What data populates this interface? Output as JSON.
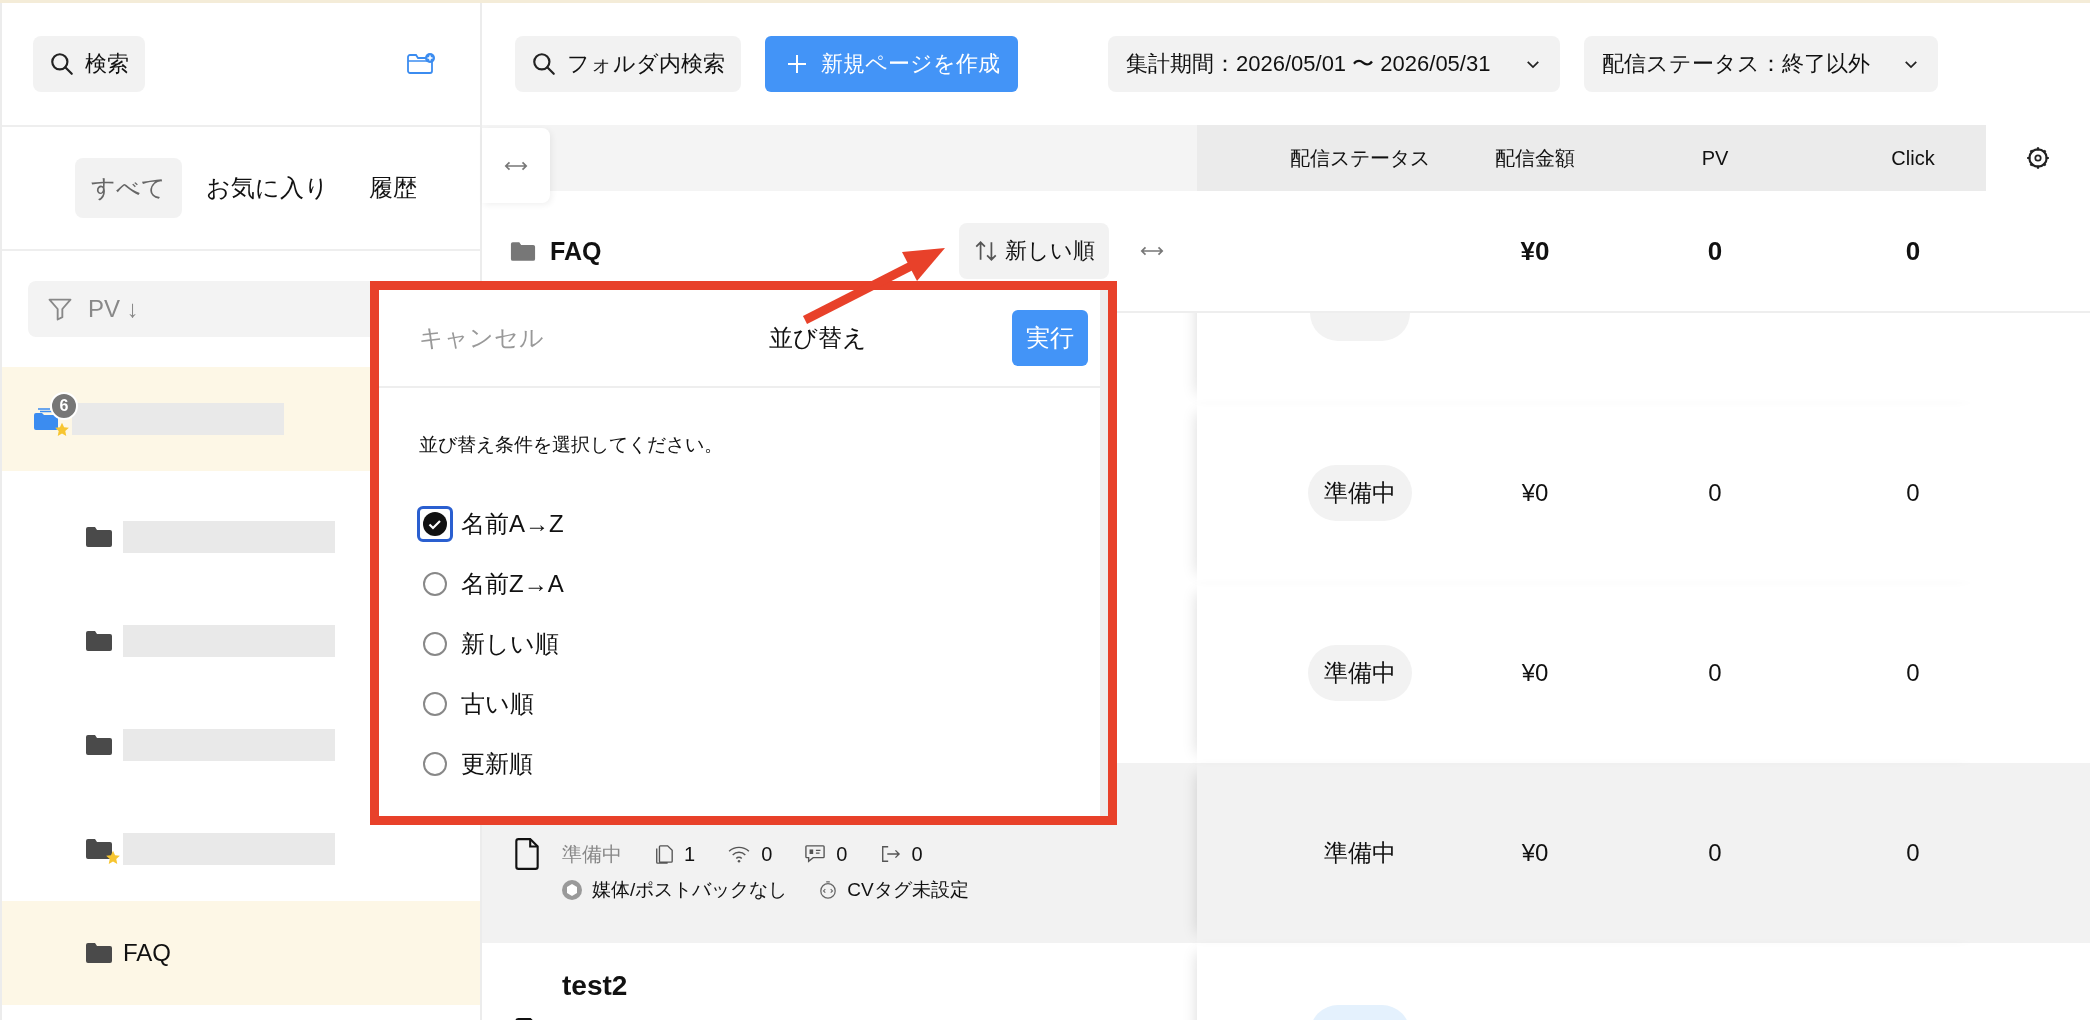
{
  "sidebar": {
    "search_button": "検索",
    "tabs": [
      {
        "label": "すべて",
        "selected": true
      },
      {
        "label": "お気に入り",
        "selected": false
      },
      {
        "label": "履歴",
        "selected": false
      }
    ],
    "filter": "PV ↓",
    "tree": [
      {
        "redacted": true,
        "badge": "6",
        "starred": true,
        "selected": true,
        "children": [
          {
            "redacted": true,
            "starred": false,
            "selected": false
          },
          {
            "redacted": true,
            "starred": false,
            "selected": false
          },
          {
            "redacted": true,
            "starred": false,
            "selected": false
          },
          {
            "redacted": true,
            "starred": true,
            "selected": false
          },
          {
            "label": "FAQ",
            "redacted": false,
            "starred": false,
            "selected": true
          }
        ]
      }
    ]
  },
  "toolbar": {
    "folder_search_button": "フォルダ内検索",
    "create_button": "新規ページを作成",
    "period_dropdown": "集計期間：2026/05/01 〜 2026/05/31",
    "status_dropdown": "配信ステータス：終了以外"
  },
  "table": {
    "columns": [
      "配信ステータス",
      "配信金額",
      "PV",
      "Click"
    ],
    "folder": {
      "name": "FAQ",
      "sort_button": "新しい順",
      "amount": "¥0",
      "pv": "0",
      "click": "0"
    },
    "rows": [
      {
        "color": "#f2f2f2",
        "hovered": false
      },
      {
        "status": "準備中",
        "color": "#f2f2f2",
        "amount": "¥0",
        "pv": "0",
        "click": "0",
        "hovered": false
      },
      {
        "status": "準備中",
        "color": "#f2f2f2",
        "amount": "¥0",
        "pv": "0",
        "click": "0",
        "hovered": false
      },
      {
        "status": "準備中",
        "color": "#f2f2f2",
        "amount": "¥0",
        "pv": "0",
        "click": "0",
        "hovered": true,
        "meta": {
          "status": "準備中",
          "pages": "1",
          "signals": "0",
          "messages": "0",
          "exits": "0",
          "media": "媒体/ポストバックなし",
          "cv_tag": "CVタグ未設定"
        }
      },
      {
        "name": "test2",
        "color": "#e4f1fd",
        "hovered": false
      }
    ]
  },
  "sort_dialog": {
    "cancel_button": "キャンセル",
    "title": "並び替え",
    "run_button": "実行",
    "instruction": "並び替え条件を選択してください。",
    "options": [
      {
        "label": "名前A→Z",
        "selected": true
      },
      {
        "label": "名前Z→A",
        "selected": false
      },
      {
        "label": "新しい順",
        "selected": false
      },
      {
        "label": "古い順",
        "selected": false
      },
      {
        "label": "更新順",
        "selected": false
      }
    ]
  }
}
